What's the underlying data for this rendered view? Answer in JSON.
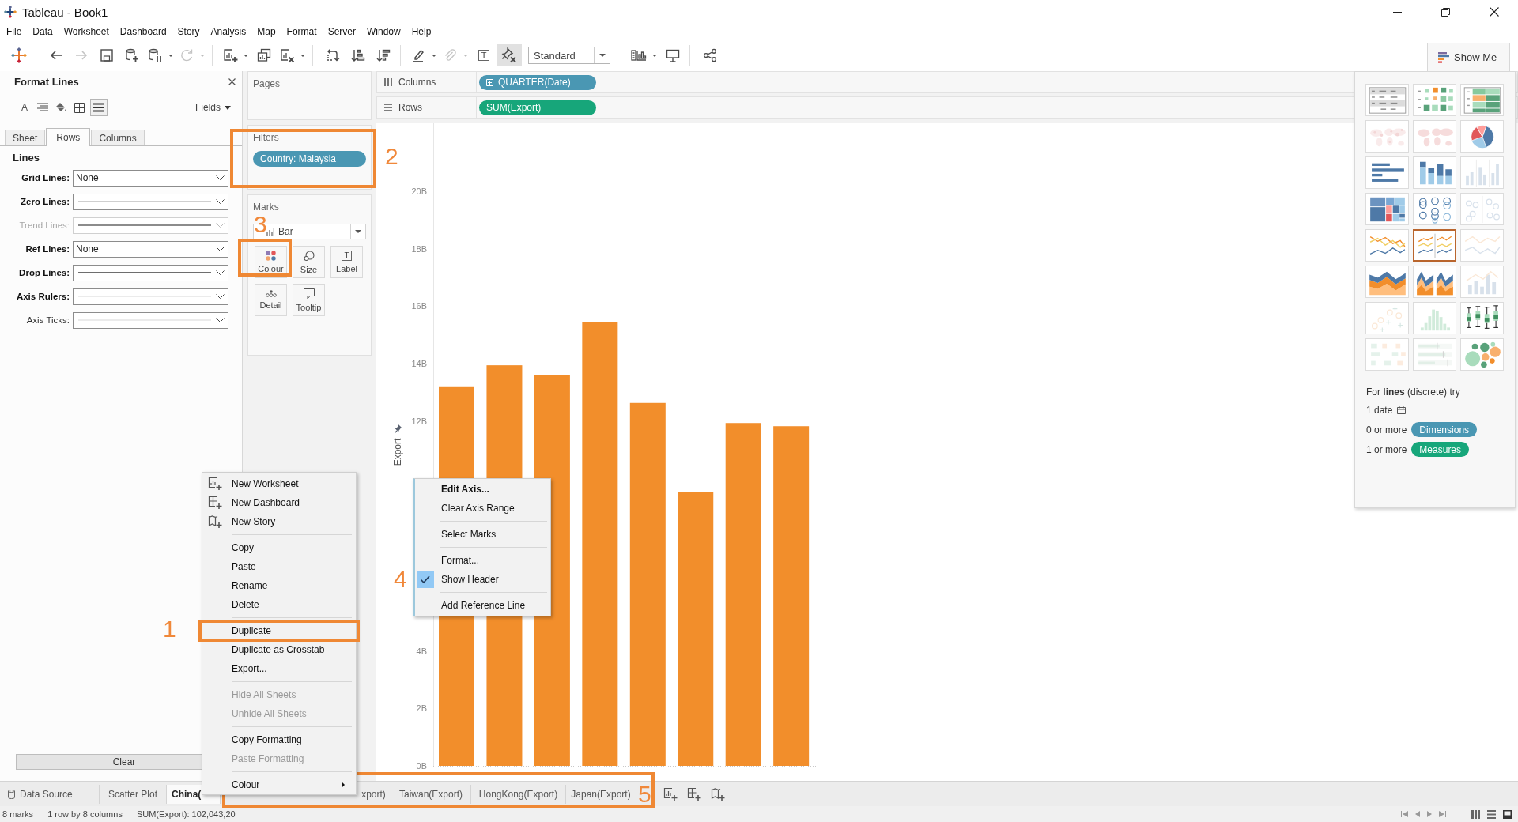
{
  "window": {
    "title": "Tableau - Book1"
  },
  "menu_bar": [
    "File",
    "Data",
    "Worksheet",
    "Dashboard",
    "Story",
    "Analysis",
    "Map",
    "Format",
    "Server",
    "Window",
    "Help"
  ],
  "toolbar": [
    {
      "kind": "logo",
      "disabled": false,
      "pressed": false,
      "menu": false
    },
    {
      "kind": "separator"
    },
    {
      "kind": "back",
      "disabled": false,
      "pressed": false,
      "menu": false
    },
    {
      "kind": "forward",
      "disabled": true,
      "pressed": false,
      "menu": false
    },
    {
      "kind": "save",
      "disabled": false,
      "pressed": false,
      "menu": false
    },
    {
      "kind": "add-data",
      "disabled": false,
      "pressed": false,
      "menu": false
    },
    {
      "kind": "pause",
      "disabled": false,
      "pressed": false,
      "menu": true
    },
    {
      "kind": "refresh",
      "disabled": true,
      "pressed": false,
      "menu": true
    },
    {
      "kind": "separator"
    },
    {
      "kind": "new-sheet",
      "disabled": false,
      "pressed": false,
      "menu": true
    },
    {
      "kind": "duplicate-sheet",
      "disabled": false,
      "pressed": false,
      "menu": false
    },
    {
      "kind": "clear-sheet",
      "disabled": false,
      "pressed": false,
      "menu": true
    },
    {
      "kind": "separator"
    },
    {
      "kind": "swap",
      "disabled": false,
      "pressed": false,
      "menu": false
    },
    {
      "kind": "sort-ascending",
      "disabled": false,
      "pressed": false,
      "menu": false
    },
    {
      "kind": "sort-descending",
      "disabled": false,
      "pressed": false,
      "menu": false
    },
    {
      "kind": "separator"
    },
    {
      "kind": "highlight",
      "disabled": false,
      "pressed": false,
      "menu": true
    },
    {
      "kind": "group",
      "disabled": true,
      "pressed": false,
      "menu": true
    },
    {
      "kind": "labels",
      "glyph": "T",
      "disabled": false,
      "pressed": false,
      "menu": false
    },
    {
      "kind": "fix-axes",
      "disabled": false,
      "pressed": true,
      "menu": false
    },
    {
      "kind": "select",
      "value": "Standard"
    },
    {
      "kind": "separator"
    },
    {
      "kind": "show-cards",
      "disabled": false,
      "pressed": false,
      "menu": true
    },
    {
      "kind": "presentation",
      "disabled": false,
      "pressed": false,
      "menu": false
    },
    {
      "kind": "separator"
    },
    {
      "kind": "share",
      "disabled": false,
      "pressed": false,
      "menu": false
    }
  ],
  "show_me_button": {
    "label": "Show Me"
  },
  "format_pane": {
    "title": "Format Lines",
    "icon_tabs": [
      {
        "kind": "font",
        "glyph": "A",
        "selected": false
      },
      {
        "kind": "alignment",
        "selected": false
      },
      {
        "kind": "shading",
        "selected": false
      },
      {
        "kind": "borders",
        "selected": false
      },
      {
        "kind": "lines",
        "selected": true
      }
    ],
    "fields_button": "Fields",
    "tabs": [
      {
        "label": "Sheet",
        "selected": false
      },
      {
        "label": "Rows",
        "selected": true
      },
      {
        "label": "Columns",
        "selected": false
      }
    ],
    "section": "Lines",
    "rows": [
      {
        "label": "Grid Lines:",
        "kind": "text",
        "value": "None",
        "modified": true,
        "disabled": false
      },
      {
        "label": "Zero Lines:",
        "kind": "line",
        "color": "#cfcfcf",
        "modified": true,
        "disabled": false
      },
      {
        "label": "Trend Lines:",
        "kind": "line",
        "color": "#8c8c8c",
        "modified": false,
        "disabled": true
      },
      {
        "label": "Ref Lines:",
        "kind": "text",
        "value": "None",
        "modified": true,
        "disabled": false
      },
      {
        "label": "Drop Lines:",
        "kind": "line",
        "color": "#6e6e6e",
        "modified": true,
        "disabled": false
      },
      {
        "label": "Axis Rulers:",
        "kind": "line",
        "color": "#ebebeb",
        "modified": true,
        "disabled": false
      },
      {
        "label": "Axis Ticks:",
        "kind": "line",
        "color": "#ebebeb",
        "modified": false,
        "disabled": false
      }
    ],
    "clear_button": "Clear"
  },
  "shelves": {
    "pages": "Pages",
    "filters": {
      "title": "Filters",
      "pills": [
        {
          "label": "Country: Malaysia",
          "kind": "dimension"
        }
      ]
    },
    "marks": {
      "title": "Marks",
      "mark_type": "Bar",
      "cards": [
        {
          "kind": "color",
          "label": "Colour"
        },
        {
          "kind": "size",
          "label": "Size"
        },
        {
          "kind": "label",
          "label": "Label",
          "glyph": "T"
        },
        {
          "kind": "detail",
          "label": "Detail"
        },
        {
          "kind": "tooltip",
          "label": "Tooltip"
        }
      ]
    }
  },
  "columns_shelf": {
    "label": "Columns",
    "pills": [
      {
        "label": "QUARTER(Date)",
        "kind": "dimension",
        "expandable": true
      }
    ]
  },
  "rows_shelf": {
    "label": "Rows",
    "pills": [
      {
        "label": "SUM(Export)",
        "kind": "measure",
        "expandable": false
      }
    ]
  },
  "chart": {
    "chart_data": {
      "type": "bar",
      "ylabel": "Export",
      "ylim": [
        0,
        22.36
      ],
      "yticks": [
        {
          "value": 0,
          "label": "0B"
        },
        {
          "value": 2,
          "label": "2B"
        },
        {
          "value": 4,
          "label": "4B"
        },
        {
          "value": 12,
          "label": "12B"
        },
        {
          "value": 14,
          "label": "14B"
        },
        {
          "value": 16,
          "label": "16B"
        },
        {
          "value": 18,
          "label": "18B"
        },
        {
          "value": 20,
          "label": "20B"
        }
      ],
      "series": [
        {
          "color": "#f28e2b",
          "values": [
            13.18,
            13.94,
            13.59,
            15.43,
            12.63,
            9.52,
            11.93,
            11.82
          ]
        }
      ]
    }
  },
  "axis_menu": {
    "sections": [
      [
        {
          "label": "Edit Axis...",
          "default": true,
          "checked": false
        },
        {
          "label": "Clear Axis Range",
          "default": false,
          "checked": false
        }
      ],
      [
        {
          "label": "Select Marks",
          "default": false,
          "checked": false
        }
      ],
      [
        {
          "label": "Format...",
          "default": false,
          "checked": false
        },
        {
          "label": "Show Header",
          "default": false,
          "checked": true
        }
      ],
      [
        {
          "label": "Add Reference Line",
          "default": false,
          "checked": false
        }
      ]
    ]
  },
  "sheet_menu": {
    "sections": [
      [
        {
          "label": "New Worksheet",
          "kind": "worksheet",
          "disabled": false
        },
        {
          "label": "New Dashboard",
          "kind": "dashboard",
          "disabled": false
        },
        {
          "label": "New Story",
          "kind": "story",
          "disabled": false
        }
      ],
      [
        {
          "label": "Copy",
          "kind": "plain",
          "disabled": false
        },
        {
          "label": "Paste",
          "kind": "plain",
          "disabled": false
        },
        {
          "label": "Rename",
          "kind": "plain",
          "disabled": false
        },
        {
          "label": "Delete",
          "kind": "plain",
          "disabled": false
        }
      ],
      [
        {
          "label": "Duplicate",
          "kind": "plain",
          "disabled": false
        },
        {
          "label": "Duplicate as Crosstab",
          "kind": "plain",
          "disabled": false
        },
        {
          "label": "Export...",
          "kind": "plain",
          "disabled": false
        }
      ],
      [
        {
          "label": "Hide All Sheets",
          "kind": "plain",
          "disabled": true
        },
        {
          "label": "Unhide All Sheets",
          "kind": "plain",
          "disabled": true
        }
      ],
      [
        {
          "label": "Copy Formatting",
          "kind": "plain",
          "disabled": false
        },
        {
          "label": "Paste Formatting",
          "kind": "plain",
          "disabled": true
        }
      ],
      [
        {
          "label": "Colour",
          "kind": "submenu",
          "disabled": false
        }
      ]
    ]
  },
  "sheet_tabs": [
    {
      "label": "Data Source",
      "kind": "data-source",
      "selected": false
    },
    {
      "label": "Scatter Plot",
      "kind": "sheet",
      "selected": false
    },
    {
      "label": "China(",
      "kind": "sheet",
      "selected": true
    },
    {
      "label": "xport)",
      "kind": "sheet",
      "selected": false
    },
    {
      "label": "Taiwan(Export)",
      "kind": "sheet",
      "selected": false
    },
    {
      "label": "HongKong(Export)",
      "kind": "sheet",
      "selected": false
    },
    {
      "label": "Japan(Export)",
      "kind": "sheet",
      "selected": false
    }
  ],
  "status_bar": [
    "8 marks",
    "1 row by 8 columns",
    "SUM(Export): 102,043,20"
  ],
  "show_me": {
    "charts": [
      {
        "kind": "text-table",
        "available": true,
        "selected": false
      },
      {
        "kind": "heat-map",
        "available": true,
        "selected": false
      },
      {
        "kind": "highlight-table",
        "available": true,
        "selected": false
      },
      {
        "kind": "dot-map",
        "available": false,
        "selected": false
      },
      {
        "kind": "filled-map",
        "available": false,
        "selected": false
      },
      {
        "kind": "pie-chart",
        "available": true,
        "selected": false
      },
      {
        "kind": "horizontal-bar-chart",
        "available": true,
        "selected": false
      },
      {
        "kind": "stacked-bar-chart",
        "available": true,
        "selected": false
      },
      {
        "kind": "side-by-side-bar-chart",
        "available": false,
        "selected": false
      },
      {
        "kind": "treemap",
        "available": true,
        "selected": false
      },
      {
        "kind": "circle-chart",
        "available": true,
        "selected": false
      },
      {
        "kind": "side-by-side-circle-chart",
        "available": false,
        "selected": false
      },
      {
        "kind": "line-chart",
        "available": true,
        "selected": false
      },
      {
        "kind": "split-line-chart",
        "available": true,
        "selected": true
      },
      {
        "kind": "dual-line-chart",
        "available": false,
        "selected": false
      },
      {
        "kind": "area-chart",
        "available": true,
        "selected": false
      },
      {
        "kind": "split-area-chart",
        "available": true,
        "selected": false
      },
      {
        "kind": "bar-line-chart",
        "available": false,
        "selected": false
      },
      {
        "kind": "scatter-plot",
        "available": false,
        "selected": false
      },
      {
        "kind": "histogram",
        "available": false,
        "selected": false
      },
      {
        "kind": "box-plot",
        "available": true,
        "selected": false
      },
      {
        "kind": "gantt-chart",
        "available": false,
        "selected": false
      },
      {
        "kind": "bullet-chart",
        "available": false,
        "selected": false
      },
      {
        "kind": "bubble-chart",
        "available": true,
        "selected": false
      }
    ],
    "hint": "For **lines** (discrete) try",
    "requirements": [
      {
        "text": "1 date",
        "kind": "date"
      },
      {
        "text": "0 or more",
        "kind": "dimension",
        "pill": "Dimensions"
      },
      {
        "text": "1 or more",
        "kind": "measure",
        "pill": "Measures"
      }
    ]
  },
  "annotations": [
    {
      "label": "1",
      "boxed": true
    },
    {
      "label": "2",
      "boxed": true
    },
    {
      "label": "3",
      "boxed": true
    },
    {
      "label": "4",
      "boxed": false
    },
    {
      "label": "5",
      "boxed": true
    }
  ]
}
